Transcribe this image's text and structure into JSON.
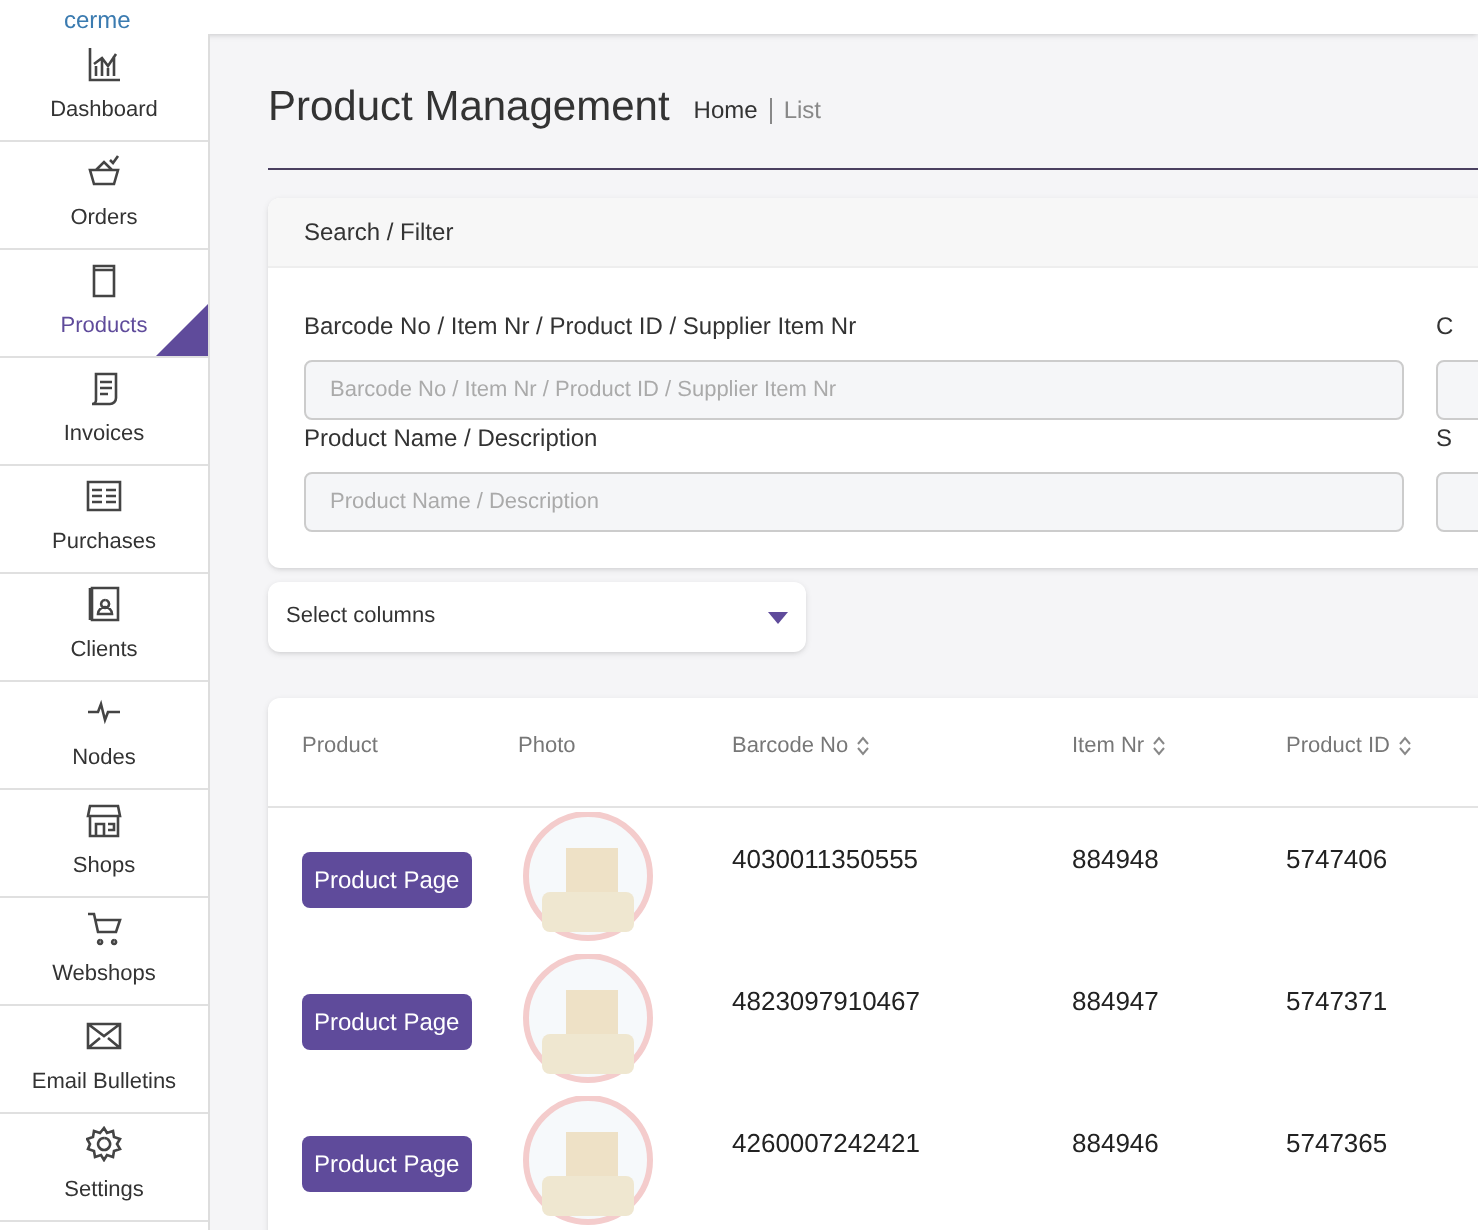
{
  "logo": "cerme",
  "sidebar": {
    "items": [
      {
        "label": "Dashboard",
        "selected": false
      },
      {
        "label": "Orders",
        "selected": false
      },
      {
        "label": "Products",
        "selected": true
      },
      {
        "label": "Invoices",
        "selected": false
      },
      {
        "label": "Purchases",
        "selected": false
      },
      {
        "label": "Clients",
        "selected": false
      },
      {
        "label": "Nodes",
        "selected": false
      },
      {
        "label": "Shops",
        "selected": false
      },
      {
        "label": "Webshops",
        "selected": false
      },
      {
        "label": "Email Bulletins",
        "selected": false
      },
      {
        "label": "Settings",
        "selected": false
      }
    ]
  },
  "page": {
    "title": "Product Management",
    "breadcrumb": [
      "Home",
      "List"
    ]
  },
  "filter": {
    "title": "Search / Filter",
    "fields": [
      {
        "label": "Barcode No / Item Nr / Product ID / Supplier Item Nr",
        "placeholder": "Barcode No / Item Nr / Product ID / Supplier Item Nr",
        "side_label": "C"
      },
      {
        "label": "Product Name / Description",
        "placeholder": "Product Name / Description",
        "side_label": "S"
      }
    ]
  },
  "column_select": {
    "label": "Select columns"
  },
  "table": {
    "columns": [
      {
        "label": "Product",
        "sortable": false
      },
      {
        "label": "Photo",
        "sortable": false
      },
      {
        "label": "Barcode No",
        "sortable": true
      },
      {
        "label": "Item Nr",
        "sortable": true
      },
      {
        "label": "Product ID",
        "sortable": true
      }
    ],
    "rows": [
      {
        "button": "Product Page",
        "barcode": "4030011350555",
        "item_nr": "884948",
        "product_id": "5747406"
      },
      {
        "button": "Product Page",
        "barcode": "4823097910467",
        "item_nr": "884947",
        "product_id": "5747371"
      },
      {
        "button": "Product Page",
        "barcode": "4260007242421",
        "item_nr": "884946",
        "product_id": "5747365"
      }
    ]
  }
}
